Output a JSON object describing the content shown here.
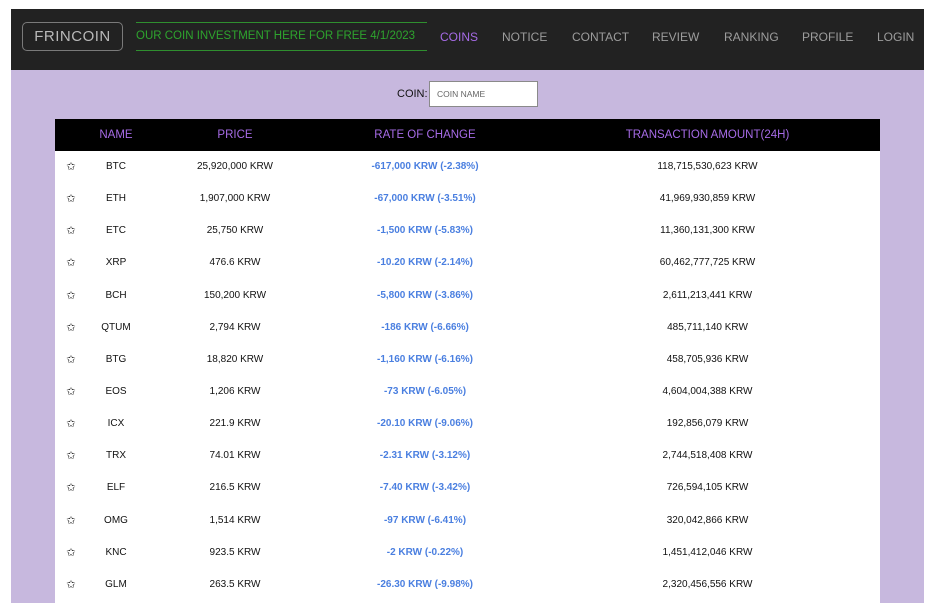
{
  "navbar": {
    "logo": "FRINCOIN",
    "ticker": "OUR COIN INVESTMENT HERE FOR FREE 4/1/2023",
    "items": [
      "COINS",
      "NOTICE",
      "CONTACT",
      "REVIEW",
      "RANKING",
      "PROFILE",
      "LOGIN"
    ],
    "active": "COINS",
    "accent_color": "#a66be6",
    "ticker_color": "#2ea42e"
  },
  "search": {
    "label": "COIN:",
    "placeholder": "COIN NAME",
    "value": ""
  },
  "table": {
    "headers": [
      "NAME",
      "PRICE",
      "RATE OF CHANGE",
      "TRANSACTION AMOUNT(24H)"
    ],
    "star_icon": "star-outline-icon",
    "star_glyph": "✩",
    "change_color": "#4a7fe0",
    "rows": [
      {
        "name": "BTC",
        "price": "25,920,000 KRW",
        "change": "-617,000 KRW (-2.38%)",
        "amount": "118,715,530,623 KRW"
      },
      {
        "name": "ETH",
        "price": "1,907,000 KRW",
        "change": "-67,000 KRW (-3.51%)",
        "amount": "41,969,930,859 KRW"
      },
      {
        "name": "ETC",
        "price": "25,750 KRW",
        "change": "-1,500 KRW (-5.83%)",
        "amount": "11,360,131,300 KRW"
      },
      {
        "name": "XRP",
        "price": "476.6 KRW",
        "change": "-10.20 KRW (-2.14%)",
        "amount": "60,462,777,725 KRW"
      },
      {
        "name": "BCH",
        "price": "150,200 KRW",
        "change": "-5,800 KRW (-3.86%)",
        "amount": "2,611,213,441 KRW"
      },
      {
        "name": "QTUM",
        "price": "2,794 KRW",
        "change": "-186 KRW (-6.66%)",
        "amount": "485,711,140 KRW"
      },
      {
        "name": "BTG",
        "price": "18,820 KRW",
        "change": "-1,160 KRW (-6.16%)",
        "amount": "458,705,936 KRW"
      },
      {
        "name": "EOS",
        "price": "1,206 KRW",
        "change": "-73 KRW (-6.05%)",
        "amount": "4,604,004,388 KRW"
      },
      {
        "name": "ICX",
        "price": "221.9 KRW",
        "change": "-20.10 KRW (-9.06%)",
        "amount": "192,856,079 KRW"
      },
      {
        "name": "TRX",
        "price": "74.01 KRW",
        "change": "-2.31 KRW (-3.12%)",
        "amount": "2,744,518,408 KRW"
      },
      {
        "name": "ELF",
        "price": "216.5 KRW",
        "change": "-7.40 KRW (-3.42%)",
        "amount": "726,594,105 KRW"
      },
      {
        "name": "OMG",
        "price": "1,514 KRW",
        "change": "-97 KRW (-6.41%)",
        "amount": "320,042,866 KRW"
      },
      {
        "name": "KNC",
        "price": "923.5 KRW",
        "change": "-2 KRW (-0.22%)",
        "amount": "1,451,412,046 KRW"
      },
      {
        "name": "GLM",
        "price": "263.5 KRW",
        "change": "-26.30 KRW (-9.98%)",
        "amount": "2,320,456,556 KRW"
      }
    ]
  }
}
